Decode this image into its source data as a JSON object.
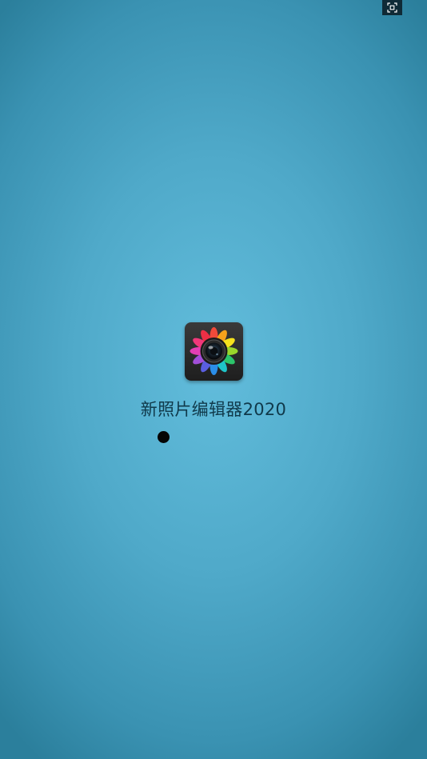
{
  "app": {
    "name": "新照片编辑器2020"
  },
  "icons": {
    "screenshot": "screenshot-frame-icon",
    "app_icon": "camera-lens-flower-icon"
  },
  "colors": {
    "background_center": "#62bddc",
    "background_edge": "#2b7f9c",
    "title_text": "#10394a",
    "loading_dot": "#050505"
  }
}
